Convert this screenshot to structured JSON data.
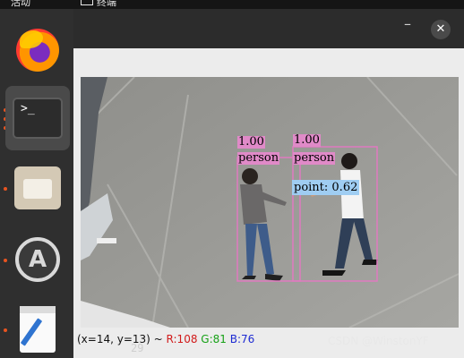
{
  "topbar": {
    "activities_label": "活动",
    "app_label": "终端"
  },
  "dock": {
    "items": [
      {
        "name": "firefox"
      },
      {
        "name": "terminal",
        "glyph": ">_"
      },
      {
        "name": "files"
      },
      {
        "name": "software",
        "glyph": "A"
      },
      {
        "name": "text-editor"
      }
    ]
  },
  "window": {
    "minimize_glyph": "–",
    "close_glyph": "✕"
  },
  "detections": [
    {
      "score": "1.00",
      "label": "person"
    },
    {
      "score": "1.00",
      "label": "person"
    }
  ],
  "point_label": "point: 0.62",
  "status": {
    "coords": "(x=14, y=13) ~",
    "r": "R:108",
    "g": "G:81",
    "b": "B:76"
  },
  "watermark": "CSDN @WinstonYF",
  "background_line_number": "29",
  "colors": {
    "box": "#e07ac0",
    "point_bg": "#9fcdf2",
    "accent_dot": "#e95420"
  }
}
